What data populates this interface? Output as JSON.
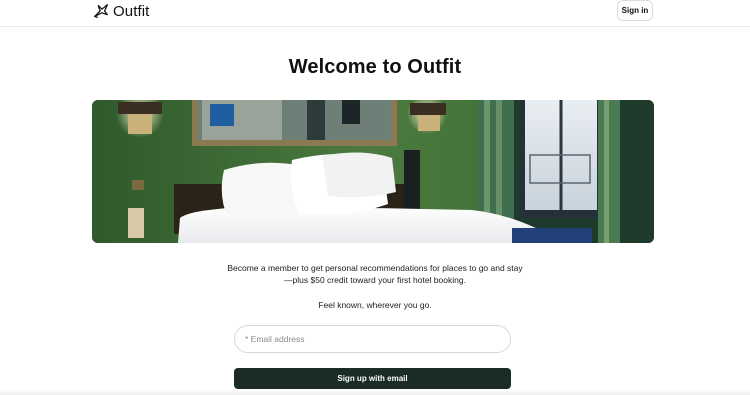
{
  "header": {
    "logo_text": "Outfit",
    "logo_icon": "bird-icon",
    "signin_label": "Sign in"
  },
  "main": {
    "title": "Welcome to Outfit",
    "hero_image": "hotel-room-photo",
    "description": "Become a member to get personal recommendations for places to go and stay—plus $50 credit toward your first hotel booking.",
    "tagline": "Feel known, wherever you go.",
    "email_placeholder": "* Email address",
    "email_value": "",
    "signup_label": "Sign up with email"
  },
  "colors": {
    "primary_button": "#1b2b26",
    "wall_green": "#3f6b3a",
    "text": "#111111"
  }
}
